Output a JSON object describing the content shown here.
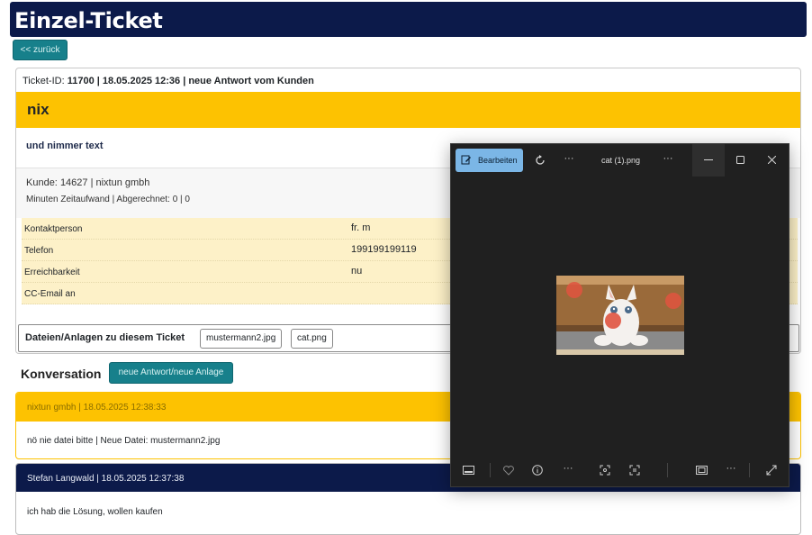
{
  "header": {
    "title": "Einzel-Ticket"
  },
  "back_button": "<< zurück",
  "ticket": {
    "id_label": "Ticket-ID:",
    "id_line": "11700 | 18.05.2025 12:36 | neue Antwort vom Kunden",
    "subject": "nix",
    "body": "und nimmer text",
    "kunde_label": "Kunde:",
    "kunde_value": "14627 | nixtun gmbh",
    "minuten": "Minuten Zeitaufwand | Abgerechnet: 0 | 0",
    "fields": [
      {
        "key": "Kontaktperson",
        "value": "fr. m"
      },
      {
        "key": "Telefon",
        "value": "199199199119"
      },
      {
        "key": "Erreichbarkeit",
        "value": "nu"
      },
      {
        "key": "CC-Email an",
        "value": ""
      }
    ],
    "files_label": "Dateien/Anlagen zu diesem Ticket",
    "files": [
      "mustermann2.jpg",
      "cat.png"
    ]
  },
  "conversation": {
    "title": "Konversation",
    "new_button": "neue Antwort/neue Anlage",
    "messages": [
      {
        "header": "nixtun gmbh | 18.05.2025 12:38:33",
        "text": "nö nie datei bitte | Neue Datei: mustermann2.jpg"
      },
      {
        "header": "Stefan Langwald | 18.05.2025 12:37:38",
        "text": "ich hab die Lösung, wollen kaufen"
      }
    ]
  },
  "viewer": {
    "edit_label": "Bearbeiten",
    "title": "cat (1).png",
    "icons": [
      "edit-icon",
      "rotate-icon",
      "more-icon",
      "minimize-icon",
      "maximize-icon",
      "close-icon",
      "filmstrip-icon",
      "favorite-icon",
      "info-icon",
      "crop-icon",
      "text-scan-icon",
      "fit-icon",
      "fullscreen-icon"
    ]
  },
  "colors": {
    "header_bg": "#0c1a4a",
    "accent_yellow": "#fdc201",
    "teal_button": "#17808b",
    "info_row_bg": "#fdf1c8",
    "viewer_bg": "#202020"
  }
}
